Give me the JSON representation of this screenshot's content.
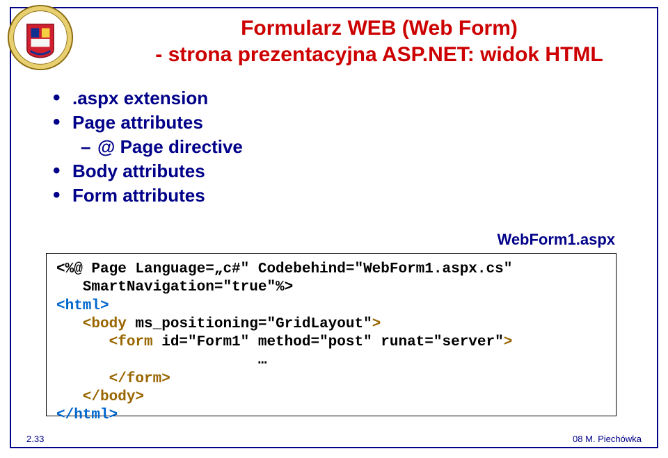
{
  "title": {
    "line1": "Formularz WEB (Web Form)",
    "line2": "- strona prezentacyjna ASP.NET: widok HTML"
  },
  "bullets": {
    "b1": ".aspx extension",
    "b2": "Page attributes",
    "b2a": "@ Page directive",
    "b3": "Body attributes",
    "b4": "Form attributes"
  },
  "label_right": "WebForm1.aspx",
  "code": {
    "l1a": "<%@ Page Language=„c#\" Codebehind=\"WebForm1.aspx.cs\"",
    "l2a": "   SmartNavigation=\"true\"%>",
    "l3a": "<html>",
    "l4b": "   <body",
    "l4c": " ms_positioning=\"GridLayout\"",
    "l4d": ">",
    "l5b": "      <form",
    "l5c": " id=\"Form1\" method=\"post\" runat=\"server\"",
    "l5d": ">",
    "l6": "                       …",
    "l7": "      </form>",
    "l8": "   </body>",
    "l9": "</html>"
  },
  "footer": {
    "left": "2.33",
    "right": "08 M. Piechówka"
  }
}
